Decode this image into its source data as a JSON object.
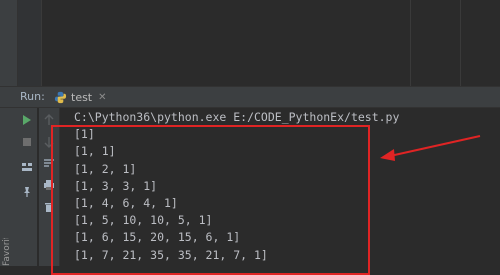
{
  "run_panel": {
    "title": "Run:",
    "tab": {
      "label": "test",
      "icon": "python-icon",
      "close": "✕"
    }
  },
  "console": {
    "lines": [
      "C:\\Python36\\python.exe E:/CODE_PythonEx/test.py",
      "[1]",
      "[1, 1]",
      "[1, 2, 1]",
      "[1, 3, 3, 1]",
      "[1, 4, 6, 4, 1]",
      "[1, 5, 10, 10, 5, 1]",
      "[1, 6, 15, 20, 15, 6, 1]",
      "[1, 7, 21, 35, 35, 21, 7, 1]"
    ]
  },
  "side_label": "Favorites",
  "colors": {
    "annotation": "#e02424",
    "console_text": "#bcbec4",
    "panel_bg": "#3c3f41",
    "editor_bg": "#2b2b2b",
    "run_green": "#59a869"
  }
}
